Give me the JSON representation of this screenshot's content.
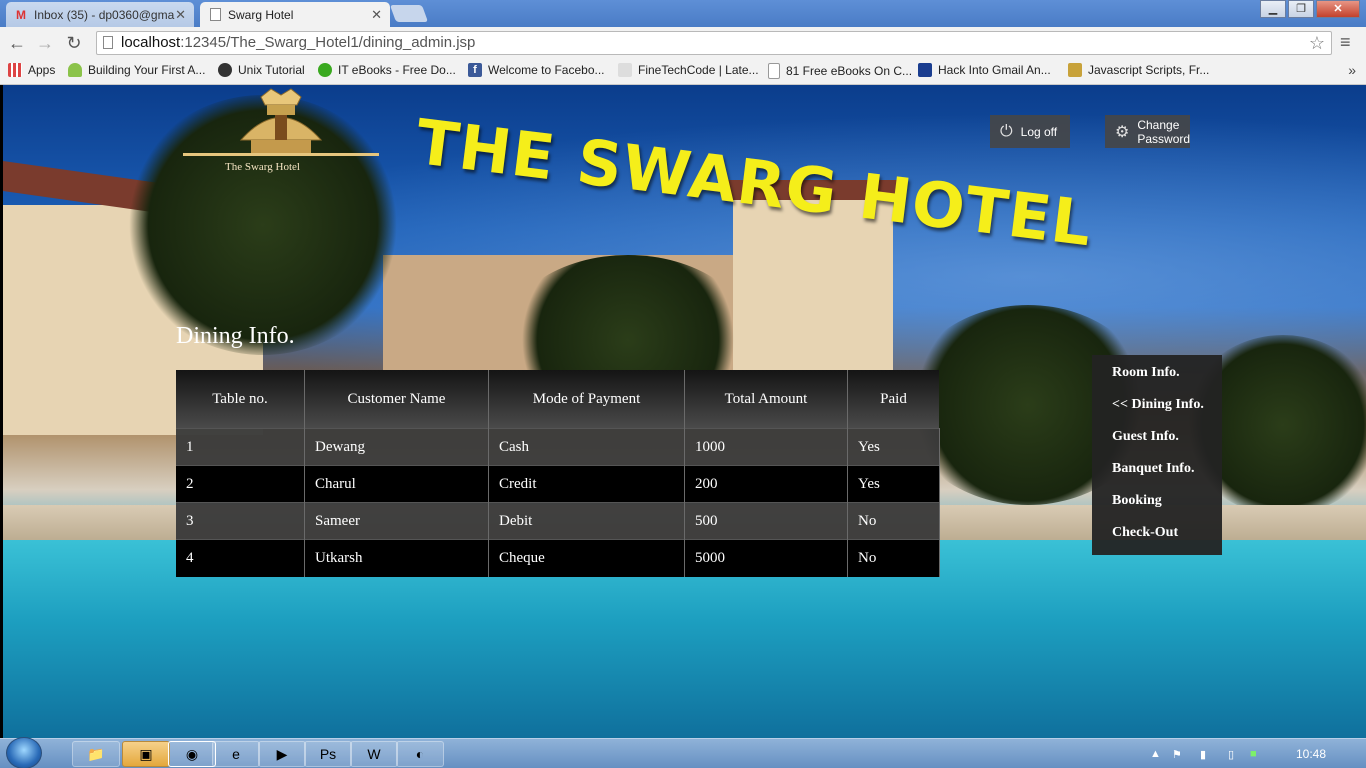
{
  "browser": {
    "tabs": [
      {
        "title": "Inbox (35) - dp0360@gma",
        "icon": "gmail-icon",
        "active": false
      },
      {
        "title": "Swarg Hotel",
        "icon": "page-icon",
        "active": true
      }
    ],
    "url_host": "localhost",
    "url_rest": ":12345/The_Swarg_Hotel1/dining_admin.jsp",
    "bookmarks": [
      {
        "label": "Apps",
        "icon": "apps-icon",
        "color": "#d44"
      },
      {
        "label": "Building Your First A...",
        "icon": "android-icon",
        "color": "#8bc34a"
      },
      {
        "label": "Unix Tutorial",
        "icon": "tux-icon",
        "color": "#333"
      },
      {
        "label": "IT eBooks - Free Do...",
        "icon": "green-circle-icon",
        "color": "#3aa91f"
      },
      {
        "label": "Welcome to Facebo...",
        "icon": "facebook-icon",
        "color": "#3b5998"
      },
      {
        "label": "FineTechCode | Late...",
        "icon": "ftc-icon",
        "color": "#666"
      },
      {
        "label": "81 Free eBooks On C...",
        "icon": "page-icon",
        "color": "#ccc"
      },
      {
        "label": "Hack Into Gmail An...",
        "icon": "efy-icon",
        "color": "#1a3d8f"
      },
      {
        "label": "Javascript Scripts, Fr...",
        "icon": "js-icon",
        "color": "#c8a23a"
      }
    ]
  },
  "header": {
    "logo_text": "The Swarg Hotel",
    "title": "THE SWARG HOTEL",
    "logoff_label": "Log off",
    "change_password_line1": "Change",
    "change_password_line2": "Password"
  },
  "main": {
    "section_title": "Dining Info.",
    "columns": [
      "Table no.",
      "Customer Name",
      "Mode of Payment",
      "Total Amount",
      "Paid"
    ],
    "rows": [
      [
        "1",
        "Dewang",
        "Cash",
        "1000",
        "Yes"
      ],
      [
        "2",
        "Charul",
        "Credit",
        "200",
        "Yes"
      ],
      [
        "3",
        "Sameer",
        "Debit",
        "500",
        "No"
      ],
      [
        "4",
        "Utkarsh",
        "Cheque",
        "5000",
        "No"
      ]
    ]
  },
  "sidemenu": {
    "items": [
      "Room Info.",
      "<< Dining Info.",
      "Guest Info.",
      "Banquet Info.",
      "Booking",
      "Check-Out"
    ]
  },
  "taskbar": {
    "clock": "10:48"
  }
}
